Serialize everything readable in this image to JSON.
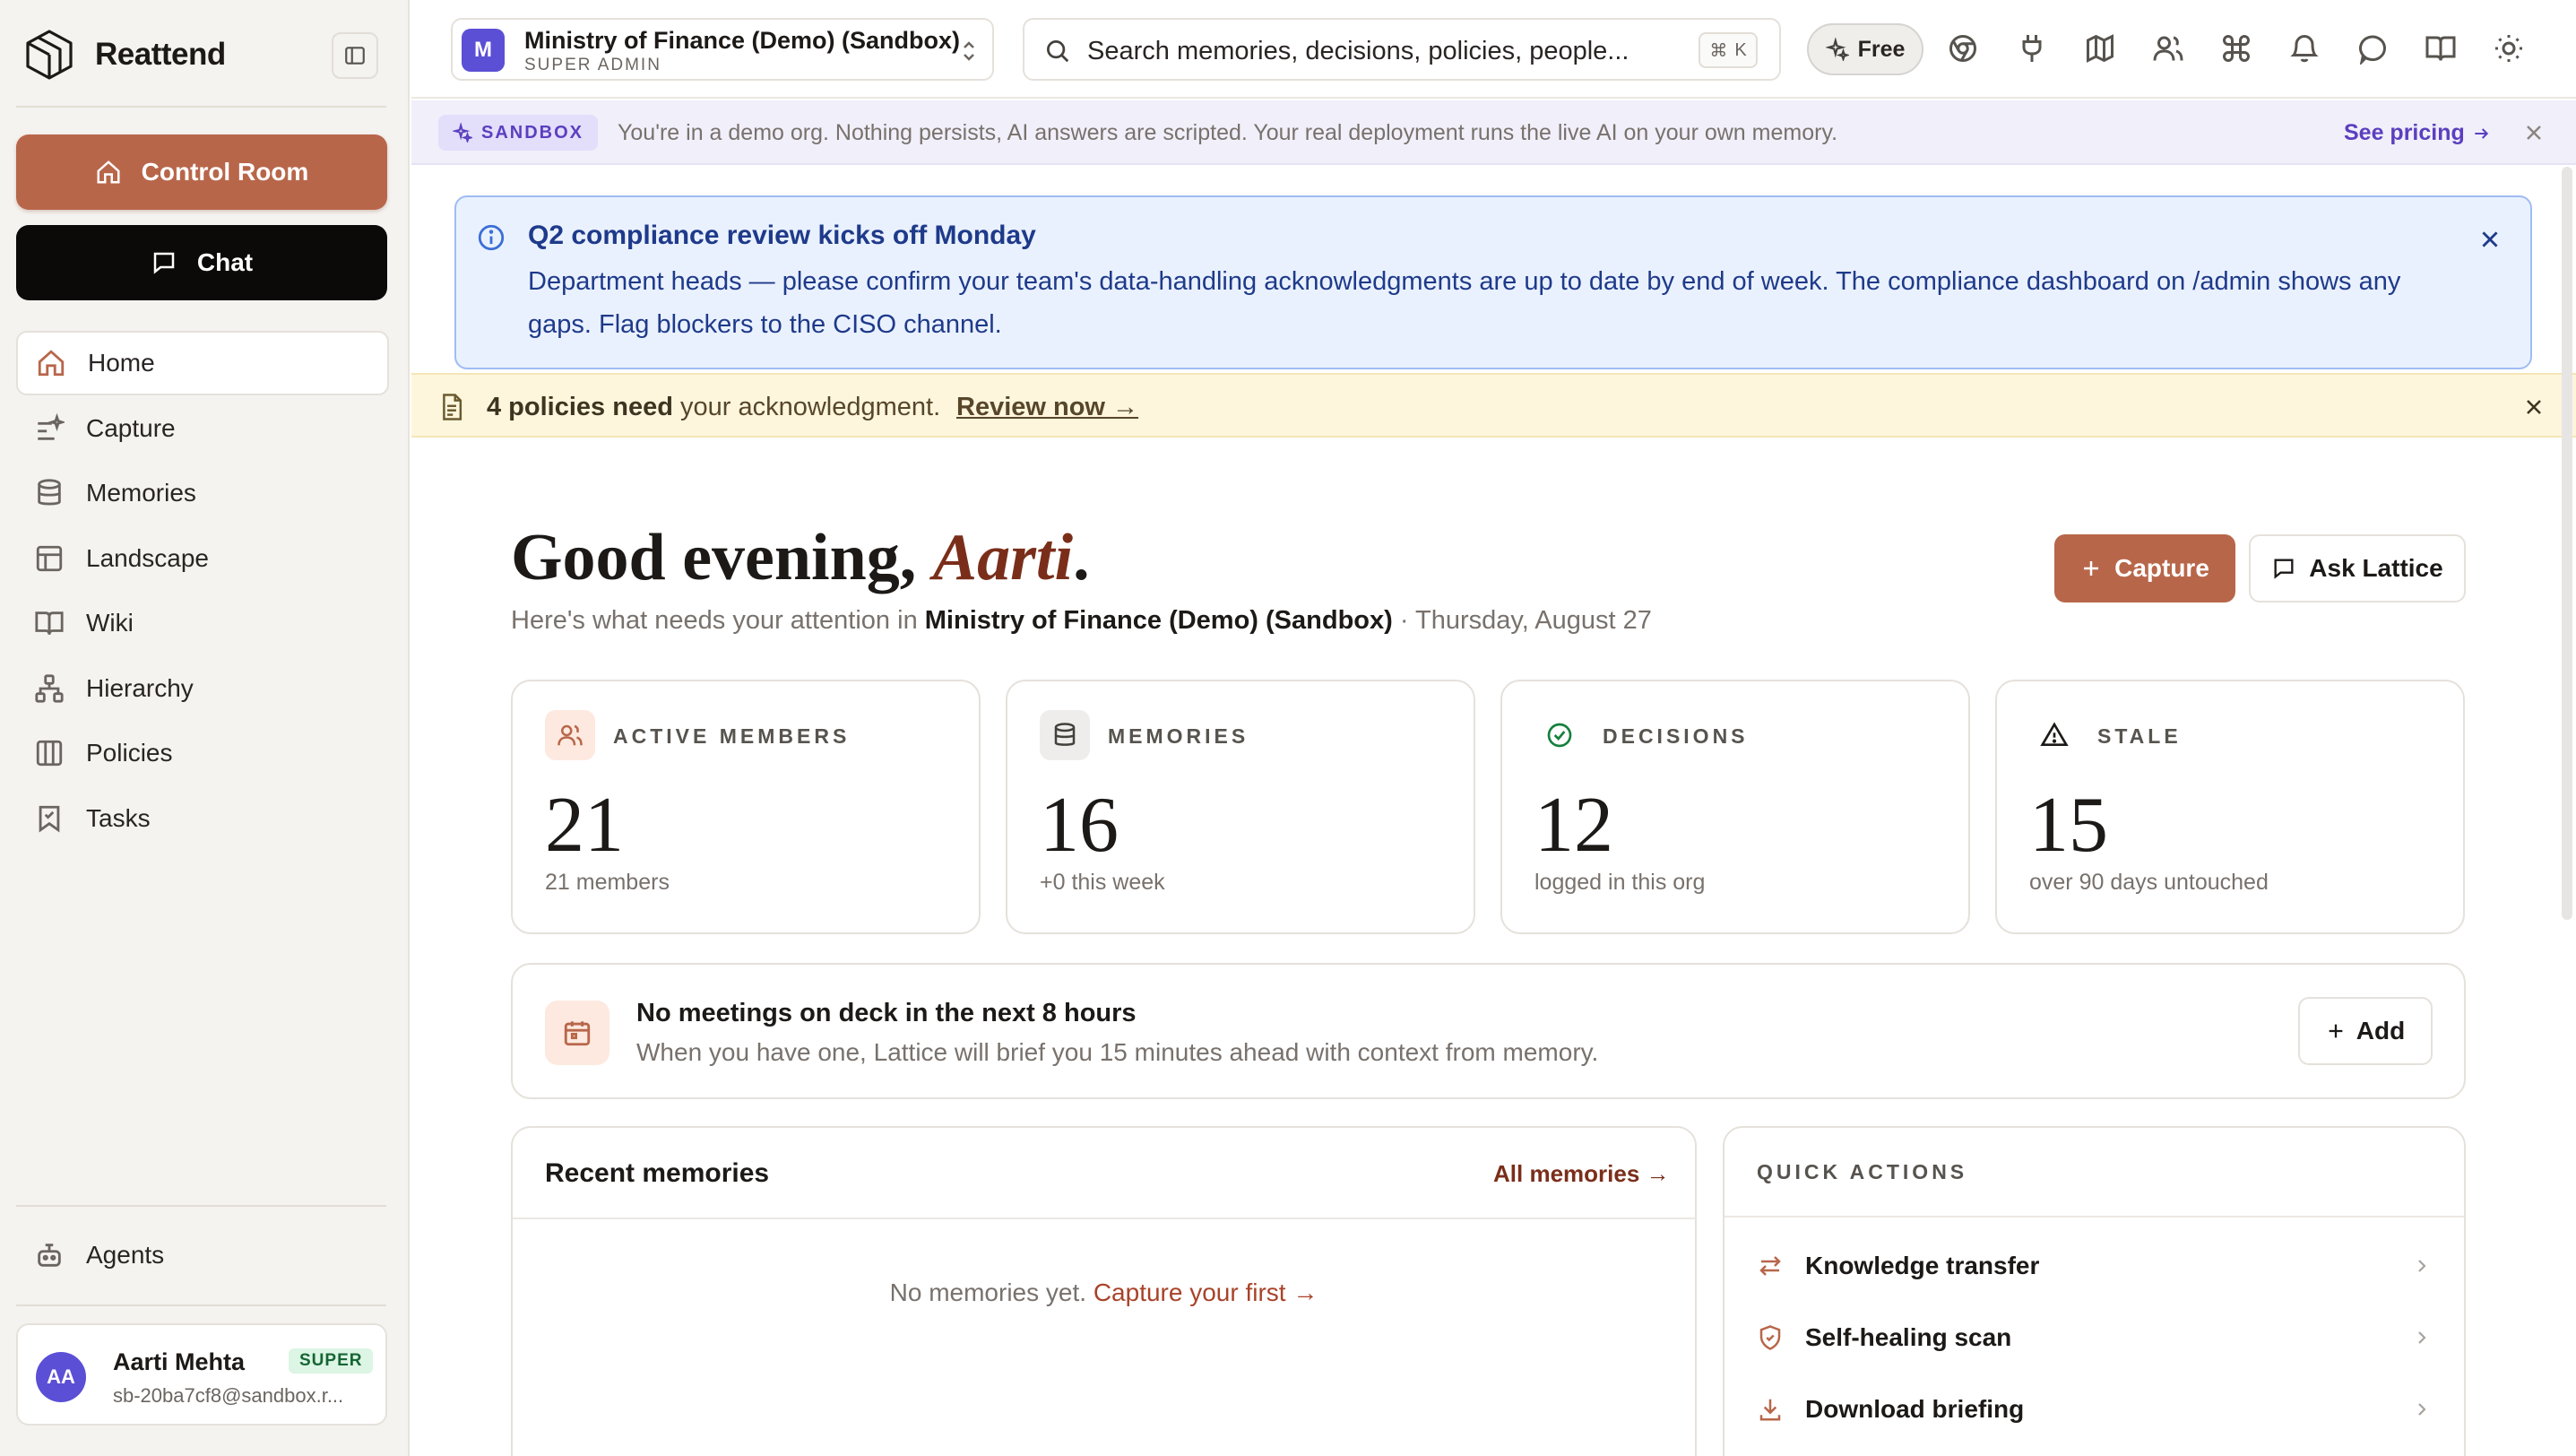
{
  "app": {
    "name": "Reattend"
  },
  "sidebar": {
    "control_room_label": "Control Room",
    "chat_label": "Chat",
    "items": [
      {
        "label": "Home",
        "icon": "home-icon",
        "active": true
      },
      {
        "label": "Capture",
        "icon": "capture-icon"
      },
      {
        "label": "Memories",
        "icon": "database-icon"
      },
      {
        "label": "Landscape",
        "icon": "layout-icon"
      },
      {
        "label": "Wiki",
        "icon": "book-icon"
      },
      {
        "label": "Hierarchy",
        "icon": "hierarchy-icon"
      },
      {
        "label": "Policies",
        "icon": "columns-icon"
      },
      {
        "label": "Tasks",
        "icon": "bookmark-check-icon"
      }
    ],
    "agents_label": "Agents",
    "user": {
      "initials": "AA",
      "name": "Aarti Mehta",
      "badge": "SUPER",
      "email": "sb-20ba7cf8@sandbox.r..."
    }
  },
  "topbar": {
    "org_initial": "M",
    "org_name": "Ministry of Finance (Demo) (Sandbox)",
    "org_role": "SUPER ADMIN",
    "search_placeholder": "Search memories, decisions, policies, people...",
    "search_shortcut_mod": "⌘",
    "search_shortcut_key": "K",
    "plan_label": "Free",
    "icons": [
      "chrome-icon",
      "plug-icon",
      "map-icon",
      "users-icon",
      "command-icon",
      "bell-icon",
      "message-icon",
      "book-open-icon",
      "sun-icon"
    ]
  },
  "sandbox_banner": {
    "tag": "SANDBOX",
    "text": "You're in a demo org. Nothing persists, AI answers are scripted. Your real deployment runs the live AI on your own memory.",
    "link": "See pricing"
  },
  "announcement": {
    "title": "Q2 compliance review kicks off Monday",
    "body": "Department heads — please confirm your team's data-handling acknowledgments are up to date by end of week. The compliance dashboard on /admin shows any gaps. Flag blockers to the CISO channel."
  },
  "policy_strip": {
    "bold": "4 policies need",
    "text": "your acknowledgment.",
    "link": "Review now →"
  },
  "greeting": {
    "prefix": "Good evening,",
    "name": "Aarti",
    "suffix": ".",
    "sub_prefix": "Here's what needs your attention in",
    "sub_org": "Ministry of Finance (Demo) (Sandbox)",
    "sub_date": "· Thursday, August 27"
  },
  "actions": {
    "capture_label": "Capture",
    "ask_label": "Ask Lattice"
  },
  "stats": [
    {
      "label": "ACTIVE MEMBERS",
      "value": "21",
      "note": "21 members",
      "icon": "users-icon",
      "bg": "#fde9df",
      "fg": "#b8664a"
    },
    {
      "label": "MEMORIES",
      "value": "16",
      "note": "+0 this week",
      "icon": "database-icon",
      "bg": "#efedeb",
      "fg": "#44403c"
    },
    {
      "label": "DECISIONS",
      "value": "12",
      "note": "logged in this org",
      "icon": "check-circle-icon",
      "bg": "#ffffff",
      "fg": "#15803d"
    },
    {
      "label": "STALE",
      "value": "15",
      "note": "over 90 days untouched",
      "icon": "warning-icon",
      "bg": "#ffffff",
      "fg": "#1c1917"
    }
  ],
  "meetings": {
    "title": "No meetings on deck in the next 8 hours",
    "body": "When you have one, Lattice will brief you 15 minutes ahead with context from memory.",
    "add_label": "Add"
  },
  "recent": {
    "title": "Recent memories",
    "link": "All memories →",
    "empty_text": "No memories yet.",
    "empty_link": "Capture your first →"
  },
  "quick_actions": {
    "title": "QUICK ACTIONS",
    "items": [
      {
        "label": "Knowledge transfer",
        "icon": "transfer-icon"
      },
      {
        "label": "Self-healing scan",
        "icon": "shield-icon"
      },
      {
        "label": "Download briefing",
        "icon": "download-icon"
      }
    ]
  },
  "colors": {
    "accent": "#b8664a",
    "brand_purple": "#5b4fd6",
    "banner_blue": "#eaf1fe",
    "policy_yellow": "#fdf6dd"
  }
}
